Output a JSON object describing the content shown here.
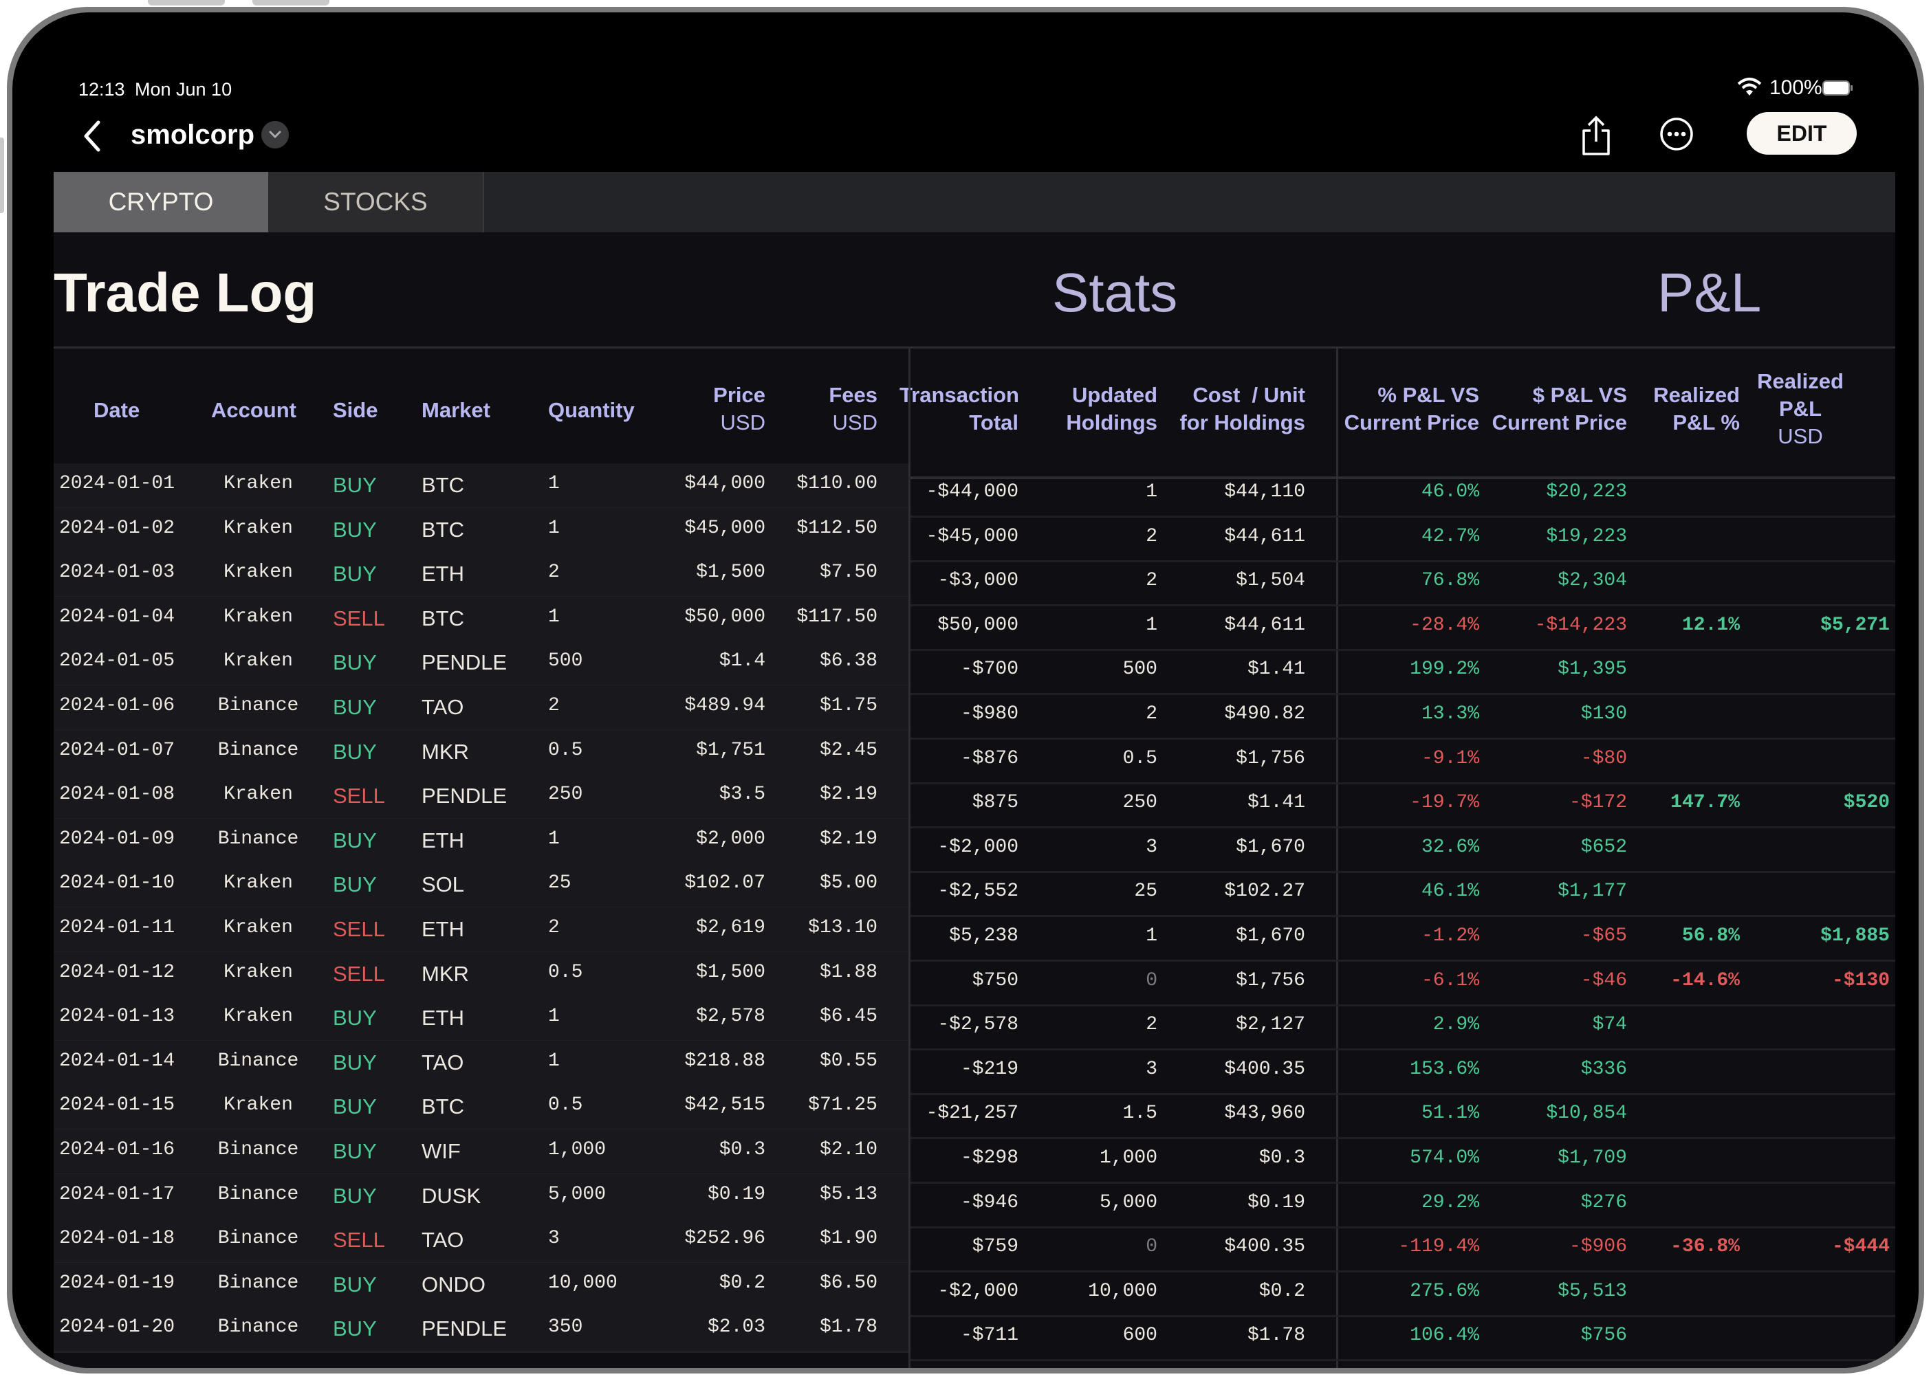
{
  "status_bar": {
    "time": "12:13",
    "date": "Mon Jun 10",
    "battery": "100%"
  },
  "nav": {
    "title": "smolcorp",
    "edit_label": "EDIT"
  },
  "tabs": [
    {
      "label": "CRYPTO",
      "active": true
    },
    {
      "label": "STOCKS",
      "active": false
    }
  ],
  "sections": {
    "trade_log": "Trade Log",
    "stats": "Stats",
    "pnl": "P&L"
  },
  "headers": {
    "date": "Date",
    "account": "Account",
    "side": "Side",
    "market": "Market",
    "quantity": "Quantity",
    "price": "Price",
    "price_unit": "USD",
    "fees": "Fees",
    "fees_unit": "USD",
    "tx_total_1": "Transaction",
    "tx_total_2": "Total",
    "holdings_1": "Updated",
    "holdings_2": "Holdings",
    "cost_1": "Cost  / Unit",
    "cost_2": "for Holdings",
    "pct_pnl_1": "% P&L VS",
    "pct_pnl_2": "Current Price",
    "usd_pnl_1": "$ P&L VS",
    "usd_pnl_2": "Current Price",
    "rpct_1": "Realized",
    "rpct_2": "P&L %",
    "rusd_1": "Realized",
    "rusd_2": "P&L",
    "rusd_3": "USD"
  },
  "colors": {
    "positive": "#4ec995",
    "negative": "#e05a5a",
    "header": "#b9b7f2"
  },
  "rows": [
    {
      "date": "2024-01-01",
      "account": "Kraken",
      "side": "BUY",
      "market": "BTC",
      "qty": "1",
      "price": "$44,000",
      "fees": "$110.00",
      "tx": "-$44,000",
      "holdings": "1",
      "cost": "$44,110",
      "pct": "46.0%",
      "usd": "$20,223",
      "rpct": "",
      "rusd": ""
    },
    {
      "date": "2024-01-02",
      "account": "Kraken",
      "side": "BUY",
      "market": "BTC",
      "qty": "1",
      "price": "$45,000",
      "fees": "$112.50",
      "tx": "-$45,000",
      "holdings": "2",
      "cost": "$44,611",
      "pct": "42.7%",
      "usd": "$19,223",
      "rpct": "",
      "rusd": ""
    },
    {
      "date": "2024-01-03",
      "account": "Kraken",
      "side": "BUY",
      "market": "ETH",
      "qty": "2",
      "price": "$1,500",
      "fees": "$7.50",
      "tx": "-$3,000",
      "holdings": "2",
      "cost": "$1,504",
      "pct": "76.8%",
      "usd": "$2,304",
      "rpct": "",
      "rusd": ""
    },
    {
      "date": "2024-01-04",
      "account": "Kraken",
      "side": "SELL",
      "market": "BTC",
      "qty": "1",
      "price": "$50,000",
      "fees": "$117.50",
      "tx": "$50,000",
      "holdings": "1",
      "cost": "$44,611",
      "pct": "-28.4%",
      "usd": "-$14,223",
      "rpct": "12.1%",
      "rusd": "$5,271"
    },
    {
      "date": "2024-01-05",
      "account": "Kraken",
      "side": "BUY",
      "market": "PENDLE",
      "qty": "500",
      "price": "$1.4",
      "fees": "$6.38",
      "tx": "-$700",
      "holdings": "500",
      "cost": "$1.41",
      "pct": "199.2%",
      "usd": "$1,395",
      "rpct": "",
      "rusd": ""
    },
    {
      "date": "2024-01-06",
      "account": "Binance",
      "side": "BUY",
      "market": "TAO",
      "qty": "2",
      "price": "$489.94",
      "fees": "$1.75",
      "tx": "-$980",
      "holdings": "2",
      "cost": "$490.82",
      "pct": "13.3%",
      "usd": "$130",
      "rpct": "",
      "rusd": ""
    },
    {
      "date": "2024-01-07",
      "account": "Binance",
      "side": "BUY",
      "market": "MKR",
      "qty": "0.5",
      "price": "$1,751",
      "fees": "$2.45",
      "tx": "-$876",
      "holdings": "0.5",
      "cost": "$1,756",
      "pct": "-9.1%",
      "usd": "-$80",
      "rpct": "",
      "rusd": ""
    },
    {
      "date": "2024-01-08",
      "account": "Kraken",
      "side": "SELL",
      "market": "PENDLE",
      "qty": "250",
      "price": "$3.5",
      "fees": "$2.19",
      "tx": "$875",
      "holdings": "250",
      "cost": "$1.41",
      "pct": "-19.7%",
      "usd": "-$172",
      "rpct": "147.7%",
      "rusd": "$520"
    },
    {
      "date": "2024-01-09",
      "account": "Binance",
      "side": "BUY",
      "market": "ETH",
      "qty": "1",
      "price": "$2,000",
      "fees": "$2.19",
      "tx": "-$2,000",
      "holdings": "3",
      "cost": "$1,670",
      "pct": "32.6%",
      "usd": "$652",
      "rpct": "",
      "rusd": ""
    },
    {
      "date": "2024-01-10",
      "account": "Kraken",
      "side": "BUY",
      "market": "SOL",
      "qty": "25",
      "price": "$102.07",
      "fees": "$5.00",
      "tx": "-$2,552",
      "holdings": "25",
      "cost": "$102.27",
      "pct": "46.1%",
      "usd": "$1,177",
      "rpct": "",
      "rusd": ""
    },
    {
      "date": "2024-01-11",
      "account": "Kraken",
      "side": "SELL",
      "market": "ETH",
      "qty": "2",
      "price": "$2,619",
      "fees": "$13.10",
      "tx": "$5,238",
      "holdings": "1",
      "cost": "$1,670",
      "pct": "-1.2%",
      "usd": "-$65",
      "rpct": "56.8%",
      "rusd": "$1,885"
    },
    {
      "date": "2024-01-12",
      "account": "Kraken",
      "side": "SELL",
      "market": "MKR",
      "qty": "0.5",
      "price": "$1,500",
      "fees": "$1.88",
      "tx": "$750",
      "holdings": "0",
      "cost": "$1,756",
      "pct": "-6.1%",
      "usd": "-$46",
      "rpct": "-14.6%",
      "rusd": "-$130"
    },
    {
      "date": "2024-01-13",
      "account": "Kraken",
      "side": "BUY",
      "market": "ETH",
      "qty": "1",
      "price": "$2,578",
      "fees": "$6.45",
      "tx": "-$2,578",
      "holdings": "2",
      "cost": "$2,127",
      "pct": "2.9%",
      "usd": "$74",
      "rpct": "",
      "rusd": ""
    },
    {
      "date": "2024-01-14",
      "account": "Binance",
      "side": "BUY",
      "market": "TAO",
      "qty": "1",
      "price": "$218.88",
      "fees": "$0.55",
      "tx": "-$219",
      "holdings": "3",
      "cost": "$400.35",
      "pct": "153.6%",
      "usd": "$336",
      "rpct": "",
      "rusd": ""
    },
    {
      "date": "2024-01-15",
      "account": "Kraken",
      "side": "BUY",
      "market": "BTC",
      "qty": "0.5",
      "price": "$42,515",
      "fees": "$71.25",
      "tx": "-$21,257",
      "holdings": "1.5",
      "cost": "$43,960",
      "pct": "51.1%",
      "usd": "$10,854",
      "rpct": "",
      "rusd": ""
    },
    {
      "date": "2024-01-16",
      "account": "Binance",
      "side": "BUY",
      "market": "WIF",
      "qty": "1,000",
      "price": "$0.3",
      "fees": "$2.10",
      "tx": "-$298",
      "holdings": "1,000",
      "cost": "$0.3",
      "pct": "574.0%",
      "usd": "$1,709",
      "rpct": "",
      "rusd": ""
    },
    {
      "date": "2024-01-17",
      "account": "Binance",
      "side": "BUY",
      "market": "DUSK",
      "qty": "5,000",
      "price": "$0.19",
      "fees": "$5.13",
      "tx": "-$946",
      "holdings": "5,000",
      "cost": "$0.19",
      "pct": "29.2%",
      "usd": "$276",
      "rpct": "",
      "rusd": ""
    },
    {
      "date": "2024-01-18",
      "account": "Binance",
      "side": "SELL",
      "market": "TAO",
      "qty": "3",
      "price": "$252.96",
      "fees": "$1.90",
      "tx": "$759",
      "holdings": "0",
      "cost": "$400.35",
      "pct": "-119.4%",
      "usd": "-$906",
      "rpct": "-36.8%",
      "rusd": "-$444"
    },
    {
      "date": "2024-01-19",
      "account": "Binance",
      "side": "BUY",
      "market": "ONDO",
      "qty": "10,000",
      "price": "$0.2",
      "fees": "$6.50",
      "tx": "-$2,000",
      "holdings": "10,000",
      "cost": "$0.2",
      "pct": "275.6%",
      "usd": "$5,513",
      "rpct": "",
      "rusd": ""
    },
    {
      "date": "2024-01-20",
      "account": "Binance",
      "side": "BUY",
      "market": "PENDLE",
      "qty": "350",
      "price": "$2.03",
      "fees": "$1.78",
      "tx": "-$711",
      "holdings": "600",
      "cost": "$1.78",
      "pct": "106.4%",
      "usd": "$756",
      "rpct": "",
      "rusd": ""
    }
  ]
}
